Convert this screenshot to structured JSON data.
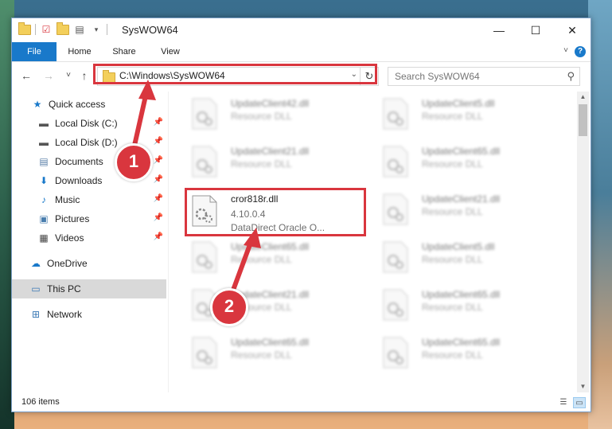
{
  "window": {
    "title": "SysWOW64",
    "controls": {
      "minimize": "—",
      "maximize": "☐",
      "close": "✕"
    }
  },
  "ribbon": {
    "tabs": [
      "File",
      "Home",
      "Share",
      "View"
    ],
    "help": "?"
  },
  "nav": {
    "back": "←",
    "forward": "→",
    "recent": "˅",
    "up": "↑",
    "address": "C:\\Windows\\SysWOW64",
    "refresh": "↻",
    "search_placeholder": "Search SysWOW64"
  },
  "sidebar": {
    "items": [
      {
        "label": "Quick access",
        "icon": "star-icon",
        "glyph": "★",
        "color": "#1979ca"
      },
      {
        "label": "Local Disk (C:)",
        "icon": "drive-icon",
        "glyph": "▬",
        "pinned": true
      },
      {
        "label": "Local Disk (D:)",
        "icon": "drive-icon",
        "glyph": "▬",
        "pinned": true
      },
      {
        "label": "Documents",
        "icon": "documents-icon",
        "glyph": "▤",
        "pinned": true
      },
      {
        "label": "Downloads",
        "icon": "download-arrow-icon",
        "glyph": "⬇",
        "pinned": true
      },
      {
        "label": "Music",
        "icon": "music-note-icon",
        "glyph": "♪",
        "pinned": true
      },
      {
        "label": "Pictures",
        "icon": "pictures-icon",
        "glyph": "▣",
        "pinned": true
      },
      {
        "label": "Videos",
        "icon": "film-icon",
        "glyph": "▦",
        "pinned": true
      },
      {
        "label": "OneDrive",
        "icon": "cloud-icon",
        "glyph": "☁"
      },
      {
        "label": "This PC",
        "icon": "computer-icon",
        "glyph": "▭",
        "selected": true
      },
      {
        "label": "Network",
        "icon": "network-icon",
        "glyph": "⊞"
      }
    ]
  },
  "files": {
    "highlighted": {
      "name": "cror818r.dll",
      "version": "4.10.0.4",
      "description": "DataDirect Oracle O..."
    },
    "background": [
      {
        "name": "UpdateClient42.dll",
        "type": "Resource DLL"
      },
      {
        "name": "UpdateClient5.dll",
        "type": "Resource DLL"
      },
      {
        "name": "UpdateClient21.dll",
        "type": "Resource DLL"
      },
      {
        "name": "UpdateClient65.dll",
        "type": "Resource DLL"
      },
      {
        "name": "UpdateClient21.dll",
        "type": "Resource DLL"
      },
      {
        "name": "UpdateClient65.dll",
        "type": "Resource DLL"
      },
      {
        "name": "UpdateClient5.dll",
        "type": "Resource DLL"
      },
      {
        "name": "UpdateClient21.dll",
        "type": "Resource DLL"
      },
      {
        "name": "UpdateClient65.dll",
        "type": "Resource DLL"
      },
      {
        "name": "UpdateClient65.dll",
        "type": "Resource DLL"
      },
      {
        "name": "UpdateClient65.dll",
        "type": "Resource DLL"
      }
    ]
  },
  "status": {
    "item_count": "106 items"
  },
  "annotations": {
    "step1": "1",
    "step2": "2",
    "accent": "#d9363e"
  }
}
